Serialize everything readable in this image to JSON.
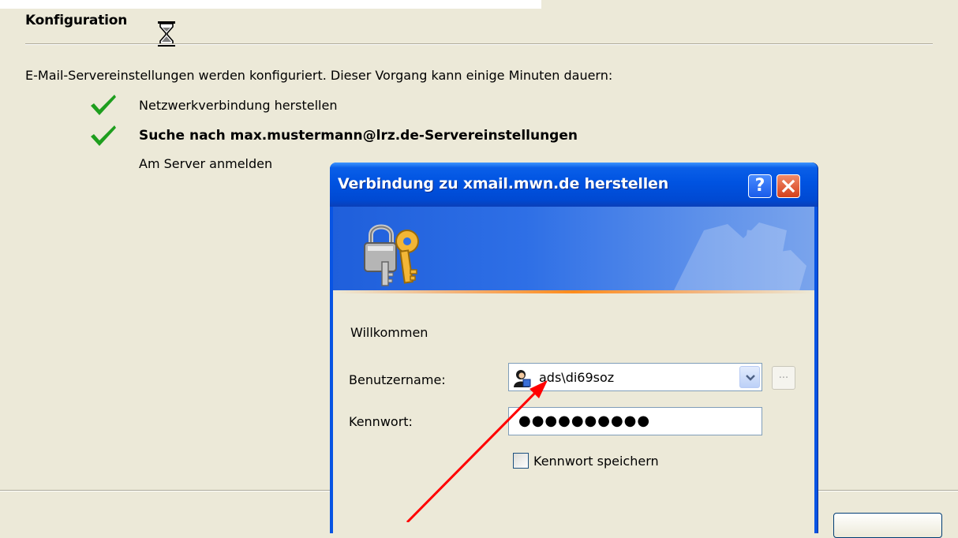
{
  "wizard": {
    "section_title": "Konfiguration",
    "intro": "E-Mail-Servereinstellungen werden konfiguriert. Dieser Vorgang kann einige Minuten dauern:",
    "steps": [
      {
        "label": "Netzwerkverbindung herstellen",
        "status": "done"
      },
      {
        "label": "Suche nach max.mustermann@lrz.de-Servereinstellungen",
        "status": "done"
      },
      {
        "label": "Am Server anmelden",
        "status": "in-progress"
      }
    ],
    "icons": {
      "busy": "hourglass-icon",
      "done": "checkmark-icon"
    },
    "colors": {
      "check": "#1e9e1e",
      "background": "#ece9d8"
    }
  },
  "dialog": {
    "title": "Verbindung zu xmail.mwn.de herstellen",
    "help_button": "?",
    "close_button": "✕",
    "banner_icon": "keys-icon",
    "welcome": "Willkommen",
    "username_label": "Benutzername:",
    "username_value": "ads\\di69soz",
    "username_icon": "user-icon",
    "browse_button": "...",
    "password_label": "Kennwort:",
    "password_value": "●●●●●●●●●●",
    "remember_password_label": "Kennwort speichern",
    "remember_password_checked": false,
    "colors": {
      "titlebar": "#0053e1",
      "close": "#d5401b",
      "accent_line": "#ff8c1c"
    }
  },
  "annotation": {
    "type": "arrow",
    "color": "#ff0000",
    "points_to": "username-combobox"
  }
}
